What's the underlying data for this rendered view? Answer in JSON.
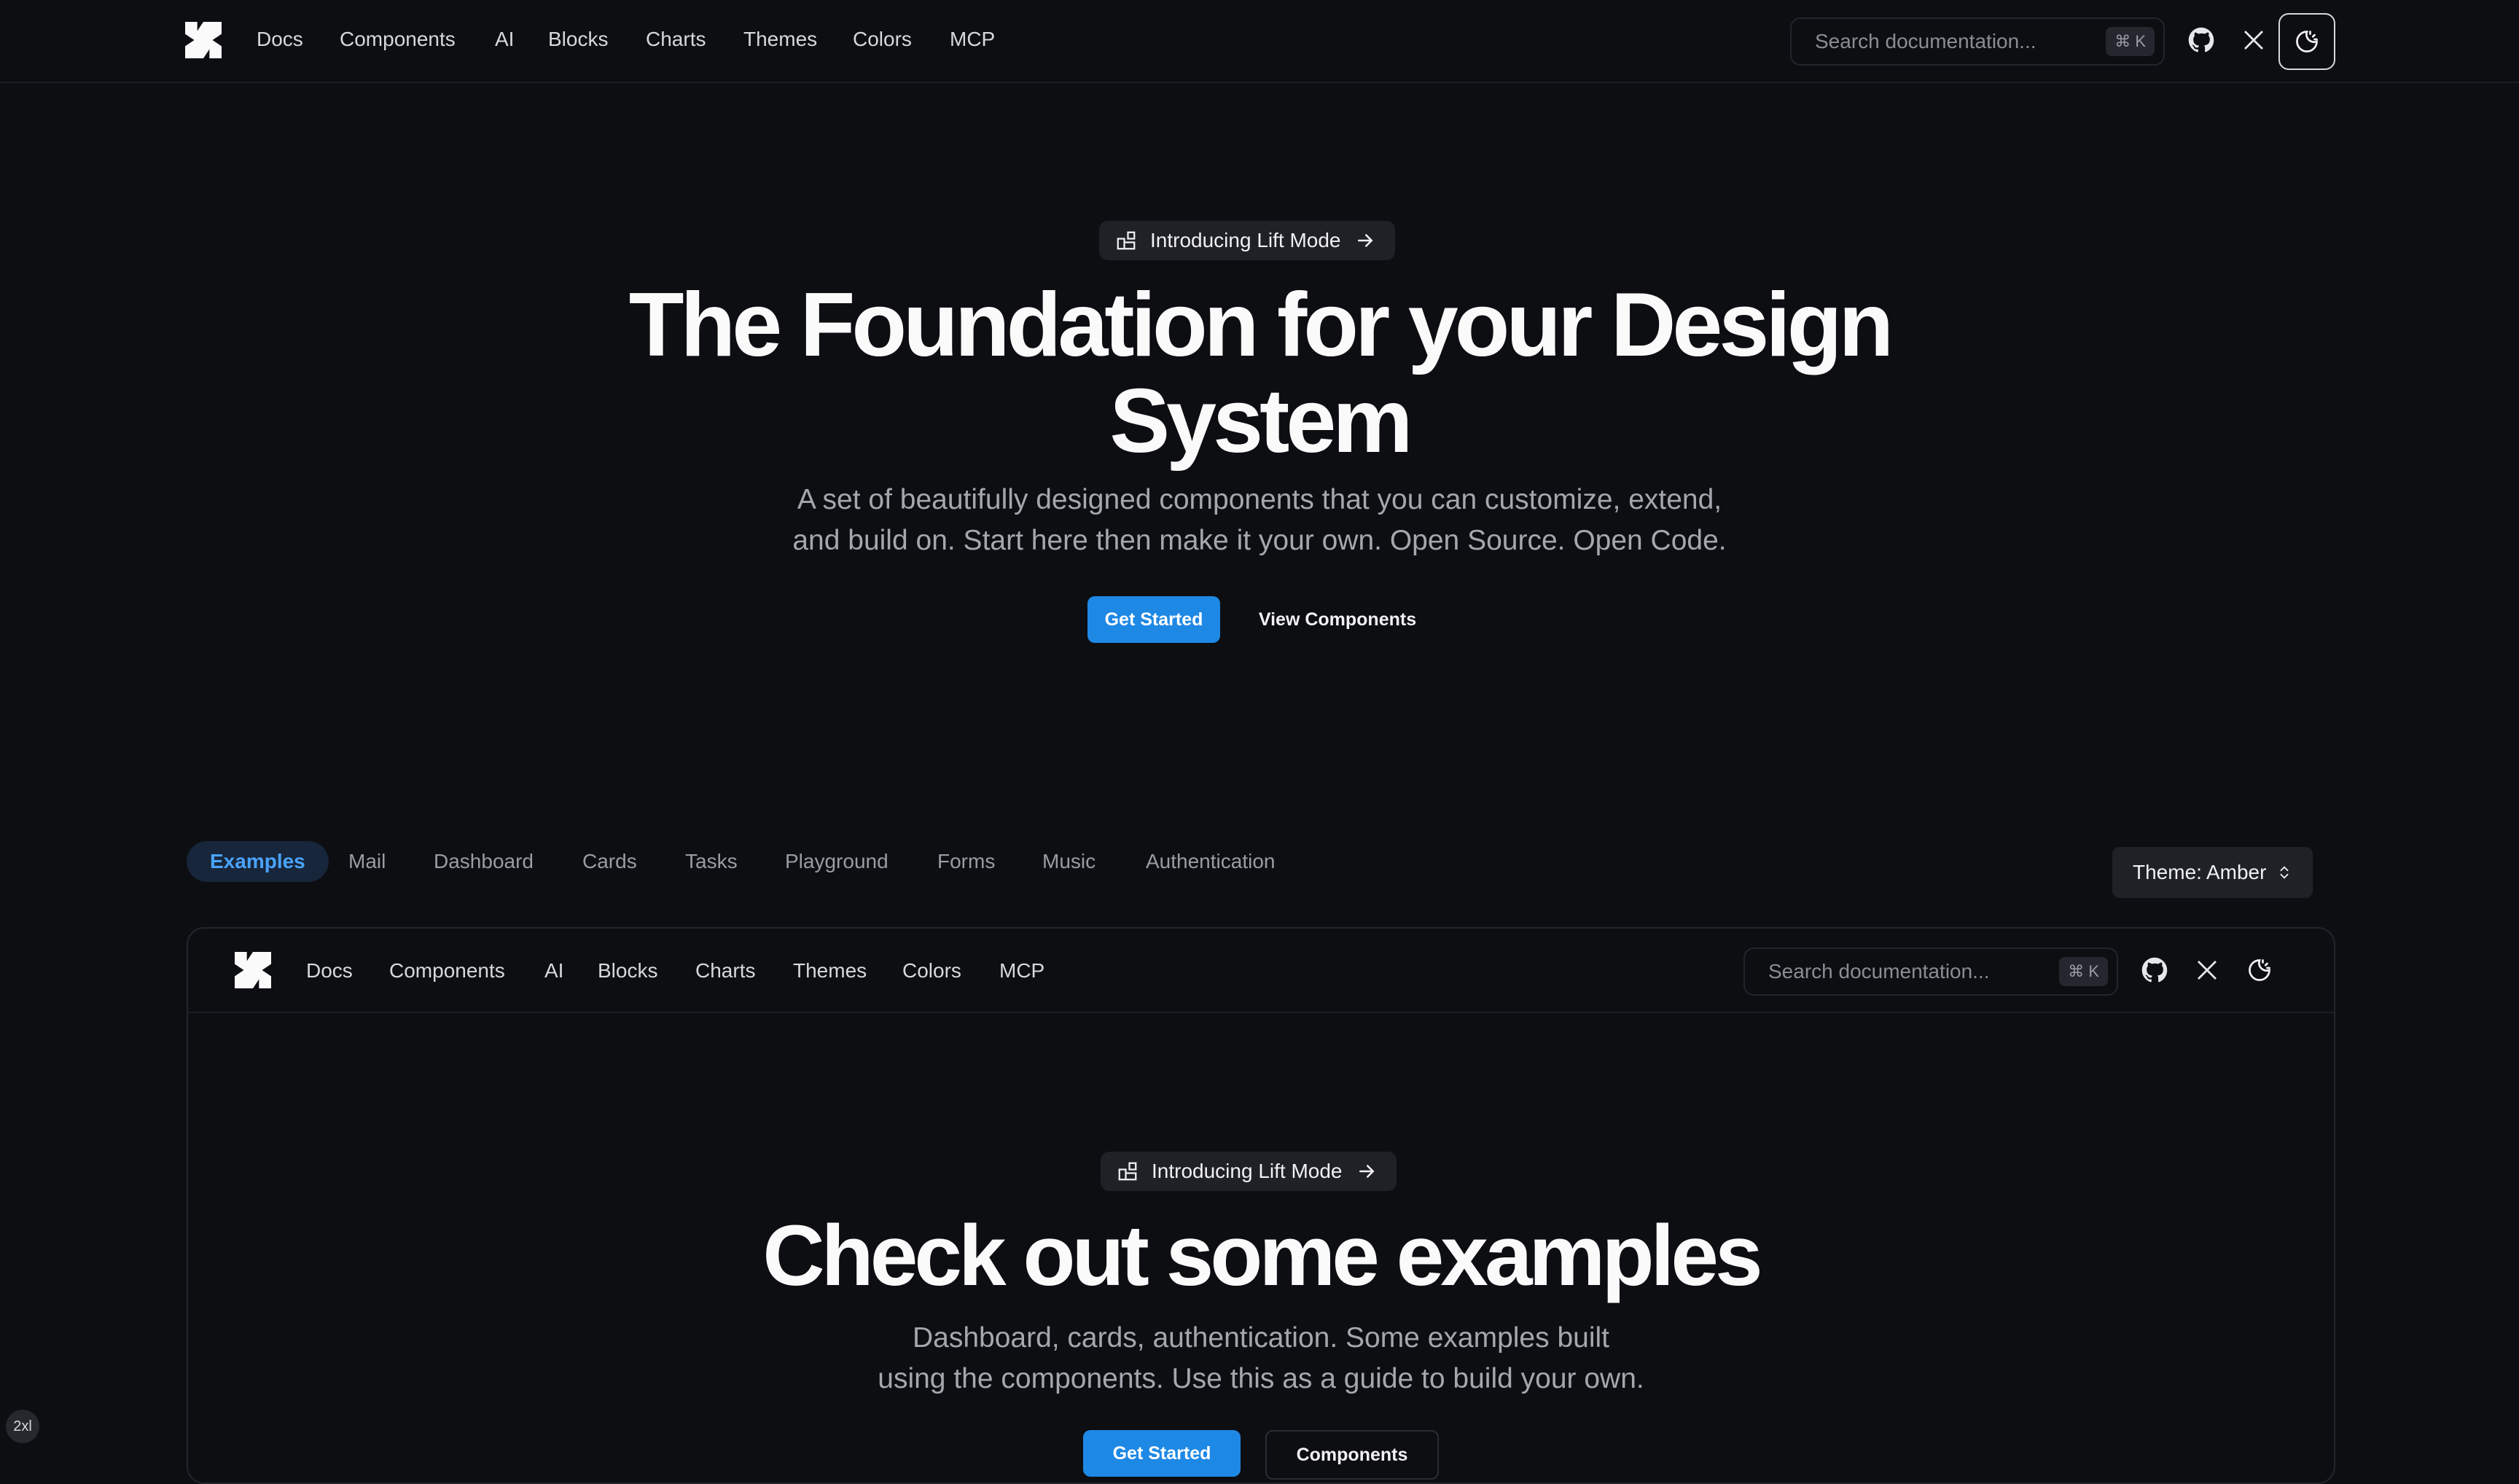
{
  "nav": {
    "logo_icon": "shadcn-logo-icon",
    "links": [
      "Docs",
      "Components",
      "AI",
      "Blocks",
      "Charts",
      "Themes",
      "Colors",
      "MCP"
    ],
    "search_placeholder": "Search documentation...",
    "search_shortcut": "⌘ K",
    "icons": [
      "github-icon",
      "x-icon",
      "theme-toggle-icon"
    ]
  },
  "hero": {
    "announcement": "Introducing Lift Mode",
    "title_line1": "The Foundation for your Design",
    "title_line2": "System",
    "subtitle_line1": "A set of beautifully designed components that you can customize, extend,",
    "subtitle_line2": "and build on. Start here then make it your own. Open Source. Open Code.",
    "primary_cta": "Get Started",
    "secondary_cta": "View Components"
  },
  "examples": {
    "tabs": [
      "Examples",
      "Mail",
      "Dashboard",
      "Cards",
      "Tasks",
      "Playground",
      "Forms",
      "Music",
      "Authentication"
    ],
    "active_tab": "Examples",
    "theme_label": "Theme:",
    "theme_value": "Amber"
  },
  "preview": {
    "nav_links": [
      "Docs",
      "Components",
      "AI",
      "Blocks",
      "Charts",
      "Themes",
      "Colors",
      "MCP"
    ],
    "search_placeholder": "Search documentation...",
    "search_shortcut": "⌘ K",
    "announcement": "Introducing Lift Mode",
    "title": "Check out some examples",
    "subtitle_line1": "Dashboard, cards, authentication. Some examples built",
    "subtitle_line2": "using the components. Use this as a guide to build your own.",
    "primary_cta": "Get Started",
    "secondary_cta": "Components"
  },
  "breakpoint_badge": "2xl",
  "colors": {
    "background": "#0d0e12",
    "accent": "#1e88e5",
    "active_tab_text": "#4aa3ff",
    "muted_text": "#a5a7ae"
  }
}
